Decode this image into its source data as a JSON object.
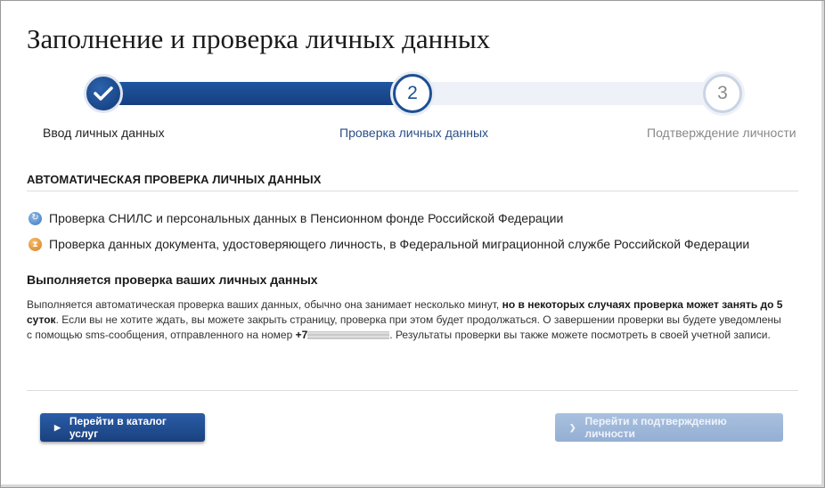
{
  "page": {
    "title": "Заполнение и проверка личных данных"
  },
  "progress": {
    "current_step": 2,
    "total_steps": 3,
    "steps": [
      {
        "number": "1",
        "label": "Ввод личных данных",
        "state": "completed"
      },
      {
        "number": "2",
        "label": "Проверка личных данных",
        "state": "current"
      },
      {
        "number": "3",
        "label": "Подтверждение личности",
        "state": "upcoming"
      }
    ]
  },
  "verification": {
    "heading": "АВТОМАТИЧЕСКАЯ ПРОВЕРКА ЛИЧНЫХ ДАННЫХ",
    "checks": [
      {
        "icon": "refresh-icon",
        "text": "Проверка СНИЛС и персональных данных в Пенсионном фонде Российской Федерации"
      },
      {
        "icon": "hourglass-icon",
        "text": "Проверка данных документа, удостоверяющего личность, в Федеральной миграционной службе Российской Федерации"
      }
    ]
  },
  "status": {
    "heading": "Выполняется проверка ваших личных данных",
    "text_part1": "Выполняется автоматическая проверка ваших данных, обычно она занимает несколько минут, ",
    "text_bold1": "но в некоторых случаях проверка может занять до 5 суток",
    "text_part2": ". Если вы не хотите ждать, вы можете закрыть страницу, проверка при этом будет продолжаться. О завершении проверки вы будете уведомлены с помощью sms-сообщения, отправленного на номер ",
    "phone_prefix": "+7",
    "text_part3": ". Результаты проверки вы также можете посмотреть в своей учетной записи."
  },
  "actions": {
    "catalog_label": "Перейти в каталог услуг",
    "confirm_label": "Перейти к подтверждению личности"
  },
  "colors": {
    "primary": "#1d4f93",
    "disabled": "#9fb8da",
    "orange": "#e08a2a"
  }
}
